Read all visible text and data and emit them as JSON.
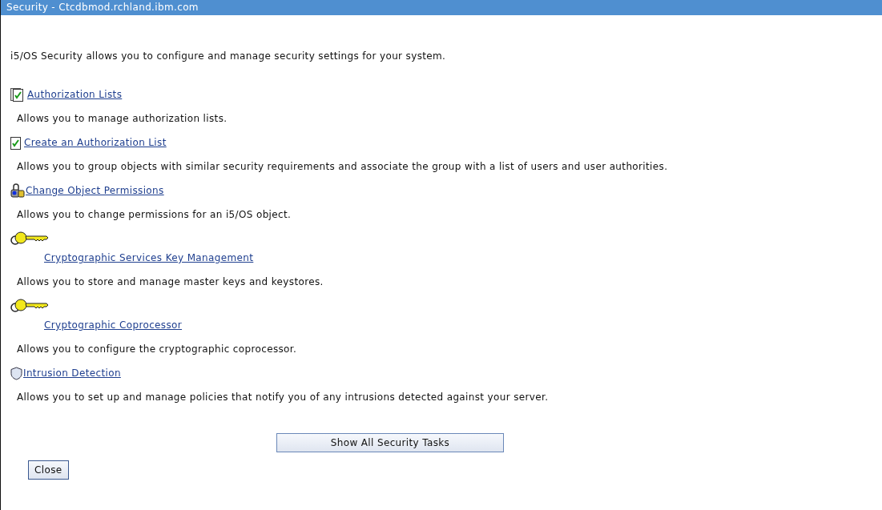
{
  "window": {
    "title": "Security - Ctcdbmod.rchland.ibm.com"
  },
  "intro": "i5/OS Security allows you to configure and manage security settings for your system.",
  "tasks": [
    {
      "kind": "list",
      "link": "Authorization Lists",
      "description": "Allows you to manage authorization lists."
    },
    {
      "kind": "create",
      "link": "Create an Authorization List",
      "description": "Allows you to group objects with similar security requirements and associate the group with a list of users and user authorities."
    },
    {
      "kind": "lock",
      "link": "Change Object Permissions",
      "description": "Allows you to change permissions for an i5/OS object."
    },
    {
      "kind": "key",
      "link": "Cryptographic Services Key Management",
      "description": "Allows you to store and manage master keys and keystores."
    },
    {
      "kind": "key",
      "link": "Cryptographic Coprocessor",
      "description": "Allows you to configure the cryptographic coprocessor."
    },
    {
      "kind": "shield",
      "link": "Intrusion Detection",
      "description": "Allows you to set up and manage policies that notify you of any intrusions detected against your server."
    }
  ],
  "buttons": {
    "show_all": "Show All Security Tasks",
    "close": "Close"
  }
}
